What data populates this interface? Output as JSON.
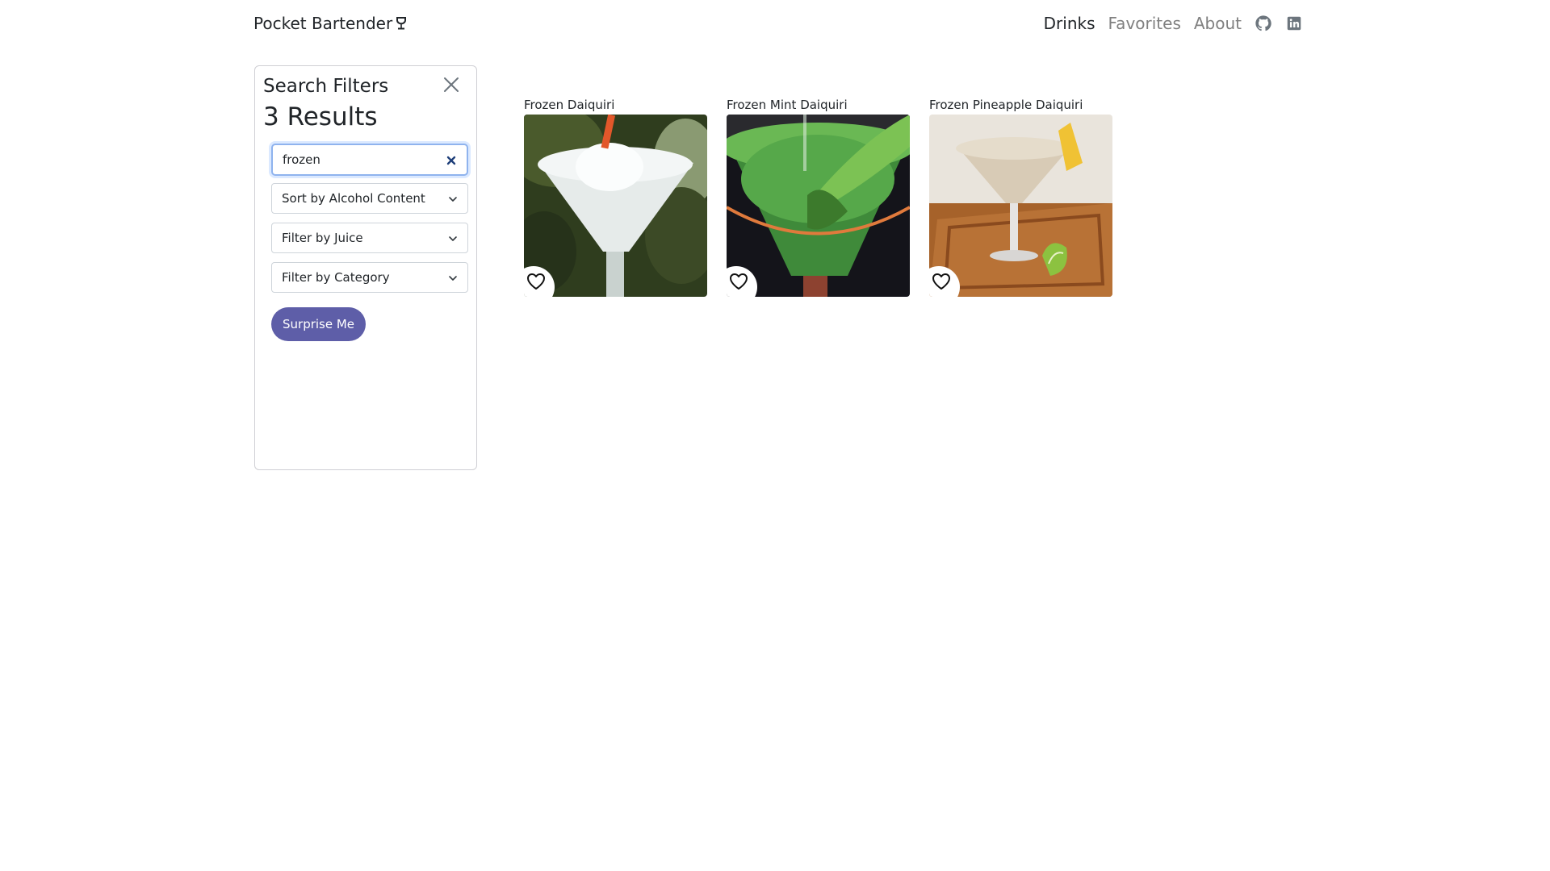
{
  "app": {
    "title": "Pocket Bartender"
  },
  "nav": {
    "links": [
      {
        "label": "Drinks",
        "active": true
      },
      {
        "label": "Favorites",
        "active": false
      },
      {
        "label": "About",
        "active": false
      }
    ],
    "icons": [
      "github-icon",
      "linkedin-icon"
    ]
  },
  "filters": {
    "title": "Search Filters",
    "results": "3 Results",
    "search_value": "frozen",
    "sort_label": "Sort by Alcohol Content",
    "juice_label": "Filter by Juice",
    "category_label": "Filter by Category",
    "surprise_label": "Surprise Me"
  },
  "drinks": [
    {
      "name": "Frozen Daiquiri",
      "favorite": false
    },
    {
      "name": "Frozen Mint Daiquiri",
      "favorite": false
    },
    {
      "name": "Frozen Pineapple Daiquiri",
      "favorite": false
    }
  ],
  "colors": {
    "accent": "#5e5ea8",
    "nav_active": "#212529",
    "nav_inactive": "#808080",
    "focus_border": "#8fb3ee"
  }
}
